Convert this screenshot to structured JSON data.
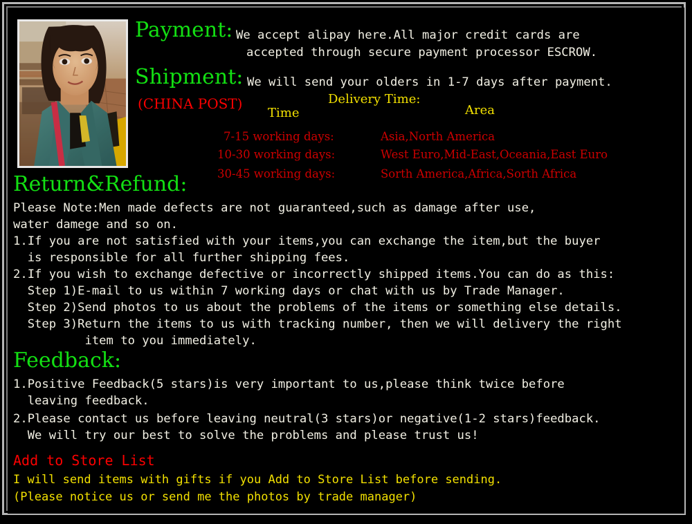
{
  "photo": {
    "alt": "seller-portrait-woman-teal-coat"
  },
  "payment": {
    "heading": "Payment:",
    "line1": "We accept alipay here.All major credit cards are",
    "line2": "accepted through secure payment processor ESCROW."
  },
  "shipment": {
    "heading": "Shipment:",
    "line1": "We will send your olders in 1-7 days after payment.",
    "carrier": "(CHINA POST)"
  },
  "delivery": {
    "title": "Delivery Time:",
    "col_time": "Time",
    "col_area": "Area",
    "rows": [
      {
        "time": "7-15 working days:",
        "area": "Asia,North America"
      },
      {
        "time": "10-30 working days:",
        "area": "West Euro,Mid-East,Oceania,East Euro"
      },
      {
        "time": "30-45 working days:",
        "area": "Sorth America,Africa,Sorth Africa"
      }
    ]
  },
  "return_refund": {
    "heading": "Return&Refund:",
    "note_line1": "Please Note:Men made defects are not guaranteed,such as damage after use,",
    "note_line2": "water damege and so on.",
    "item1_line1": "1.If you are not satisfied with your items,you can exchange the item,but the buyer",
    "item1_line2": "  is responsible for all further shipping fees.",
    "item2_line1": "2.If you wish to exchange defective or incorrectly shipped items.You can do as this:",
    "step1": "  Step 1)E-mail to us within 7 working days or chat with us by Trade Manager.",
    "step2": "  Step 2)Send photos to us about the problems of the items or something else details.",
    "step3": "  Step 3)Return the items to us with tracking number, then we will delivery the right",
    "step3_cont": "          item to you immediately."
  },
  "feedback": {
    "heading": "Feedback:",
    "item1_line1": "1.Positive Feedback(5 stars)is very important to us,please think twice before",
    "item1_line2": "  leaving feedback.",
    "item2_line1": "2.Please contact us before leaving neutral(3 stars)or negative(1-2 stars)feedback.",
    "item2_line2": "  We will try our best to solve the problems and please trust us!"
  },
  "store_list": {
    "heading": "Add to Store List",
    "line1": "I will send items with gifts if you Add to Store List before sending.",
    "line2": "(Please notice us or send me the photos by trade manager)"
  },
  "colors": {
    "background": "#000000",
    "frame": "#b6b6b6",
    "heading_green": "#13e013",
    "body_white": "#f2f0e4",
    "accent_red": "#fb0101",
    "table_red": "#cc0000",
    "accent_yellow": "#f2e000"
  }
}
